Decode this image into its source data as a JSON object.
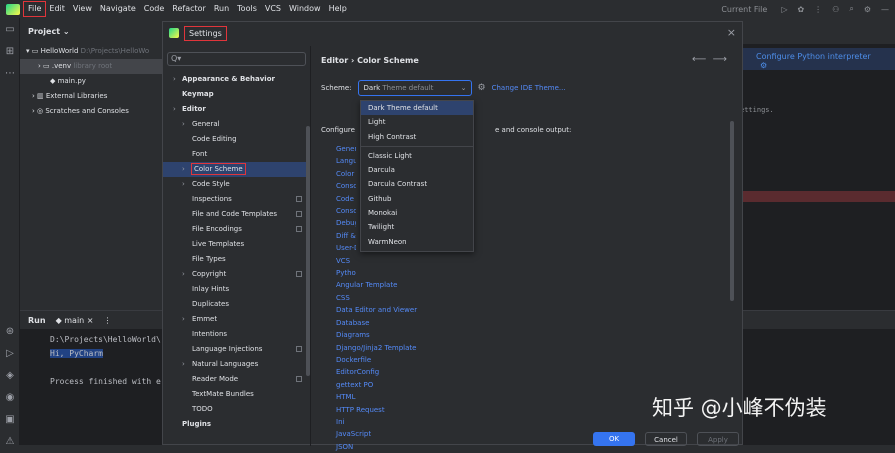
{
  "menubar": {
    "items": [
      "File",
      "Edit",
      "View",
      "Navigate",
      "Code",
      "Refactor",
      "Run",
      "Tools",
      "VCS",
      "Window",
      "Help"
    ],
    "current_file": "Current File"
  },
  "project": {
    "title": "Project",
    "tree": [
      {
        "label": "HelloWorld",
        "muted": "D:\\Projects\\HelloWo"
      },
      {
        "label": ".venv",
        "muted": "library root"
      },
      {
        "label": "main.py",
        "muted": ""
      },
      {
        "label": "External Libraries",
        "muted": ""
      },
      {
        "label": "Scratches and Consoles",
        "muted": ""
      }
    ]
  },
  "editor": {
    "notification": "Configure Python interpreter",
    "snippet": "ettings."
  },
  "run": {
    "title": "Run",
    "tab": "main",
    "lines": [
      "D:\\Projects\\HelloWorld\\",
      "Hi, PyCharm",
      "",
      "Process finished with e"
    ]
  },
  "dialog": {
    "title": "Settings",
    "search_placeholder": "Q▾",
    "nav": [
      {
        "label": "Appearance & Behavior",
        "bold": true,
        "arrow": true,
        "indent": 0
      },
      {
        "label": "Keymap",
        "bold": true,
        "arrow": false,
        "indent": 0
      },
      {
        "label": "Editor",
        "bold": true,
        "arrow": true,
        "indent": 0
      },
      {
        "label": "General",
        "arrow": true,
        "indent": 1
      },
      {
        "label": "Code Editing",
        "indent": 1
      },
      {
        "label": "Font",
        "indent": 1
      },
      {
        "label": "Color Scheme",
        "arrow": true,
        "indent": 1,
        "selected": true
      },
      {
        "label": "Code Style",
        "arrow": true,
        "indent": 1
      },
      {
        "label": "Inspections",
        "indent": 1,
        "box": true
      },
      {
        "label": "File and Code Templates",
        "indent": 1,
        "box": true
      },
      {
        "label": "File Encodings",
        "indent": 1,
        "box": true
      },
      {
        "label": "Live Templates",
        "indent": 1
      },
      {
        "label": "File Types",
        "indent": 1
      },
      {
        "label": "Copyright",
        "arrow": true,
        "indent": 1,
        "box": true
      },
      {
        "label": "Inlay Hints",
        "indent": 1
      },
      {
        "label": "Duplicates",
        "indent": 1
      },
      {
        "label": "Emmet",
        "arrow": true,
        "indent": 1
      },
      {
        "label": "Intentions",
        "indent": 1
      },
      {
        "label": "Language Injections",
        "indent": 1,
        "box": true
      },
      {
        "label": "Natural Languages",
        "arrow": true,
        "indent": 1
      },
      {
        "label": "Reader Mode",
        "indent": 1,
        "box": true
      },
      {
        "label": "TextMate Bundles",
        "indent": 1
      },
      {
        "label": "TODO",
        "indent": 1
      },
      {
        "label": "Plugins",
        "bold": true,
        "indent": 0
      }
    ],
    "breadcrumb": "Editor  ›  Color Scheme",
    "scheme_label": "Scheme:",
    "scheme_value": "Dark",
    "scheme_default": "Theme default",
    "change_ide_theme": "Change IDE Theme...",
    "configure_text": "Configure",
    "configure_text2": "e and console output:",
    "categories": [
      "General",
      "Language Defaults",
      "Color Scheme Font",
      "Console Colors",
      "Code",
      "Console Font",
      "Debugger",
      "Diff & Merge",
      "User-Defined File Types",
      "VCS",
      "Python",
      "Angular Template",
      "CSS",
      "Data Editor and Viewer",
      "Database",
      "Diagrams",
      "Django/Jinja2 Template",
      "Dockerfile",
      "EditorConfig",
      "gettext PO",
      "HTML",
      "HTTP Request",
      "Ini",
      "JavaScript",
      "JSON"
    ],
    "dropdown": {
      "group1": [
        "Dark Theme default",
        "Light",
        "High Contrast"
      ],
      "group2": [
        "Classic Light",
        "Darcula",
        "Darcula Contrast",
        "Github",
        "Monokai",
        "Twilight",
        "WarmNeon"
      ]
    },
    "buttons": {
      "ok": "OK",
      "cancel": "Cancel",
      "apply": "Apply"
    }
  },
  "watermark": "知乎 @小峰不伪装"
}
